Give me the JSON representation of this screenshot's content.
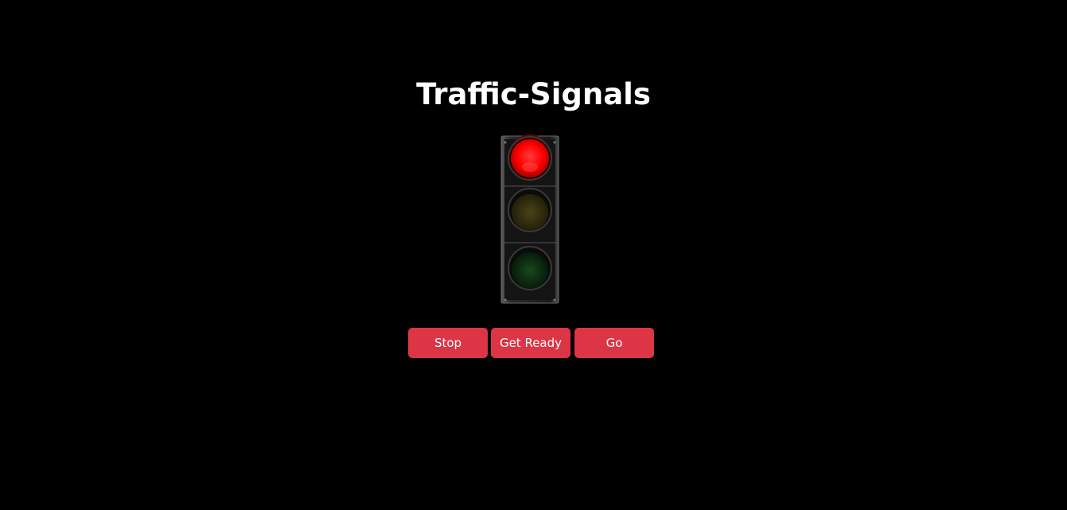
{
  "page": {
    "title": "Traffic-Signals"
  },
  "signal": {
    "active_light": "red",
    "colors": {
      "red_on": "#ff0000",
      "yellow_off": "#3a3410",
      "green_off": "#0d2a10",
      "housing": "#1e1e1e"
    }
  },
  "controls": {
    "stop_label": "Stop",
    "ready_label": "Get Ready",
    "go_label": "Go",
    "button_color": "#dc3545"
  }
}
